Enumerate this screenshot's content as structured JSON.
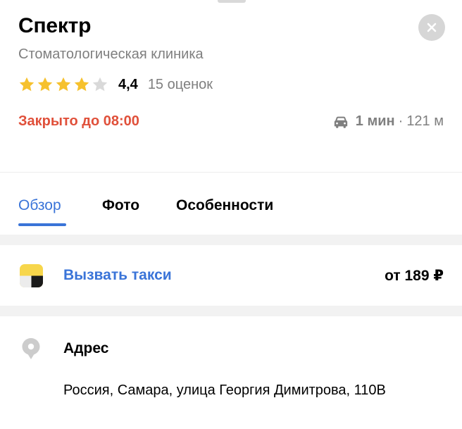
{
  "place": {
    "name": "Спектр",
    "category": "Стоматологическая клиника",
    "rating": {
      "value": "4,4",
      "stars_filled": 4,
      "stars_total": 5,
      "count_label": "15 оценок"
    },
    "status": "Закрыто до 08:00",
    "route": {
      "icon": "car-icon",
      "time": "1 мин",
      "separator": "·",
      "distance": "121 м"
    }
  },
  "tabs": [
    {
      "label": "Обзор",
      "active": true
    },
    {
      "label": "Фото",
      "active": false
    },
    {
      "label": "Особенности",
      "active": false
    }
  ],
  "taxi": {
    "icon": "taxi-icon",
    "label": "Вызвать такси",
    "price": "от 189 ₽"
  },
  "address": {
    "icon": "pin-icon",
    "title": "Адрес",
    "text": "Россия, Самара, улица Георгия Димитрова, 110В"
  },
  "colors": {
    "accent": "#3a74d8",
    "closed_status": "#e0503a",
    "star_filled": "#f6c12d",
    "star_empty": "#d9d9d9",
    "muted_text": "#7f7f7f",
    "section_background": "#f2f2f2"
  }
}
